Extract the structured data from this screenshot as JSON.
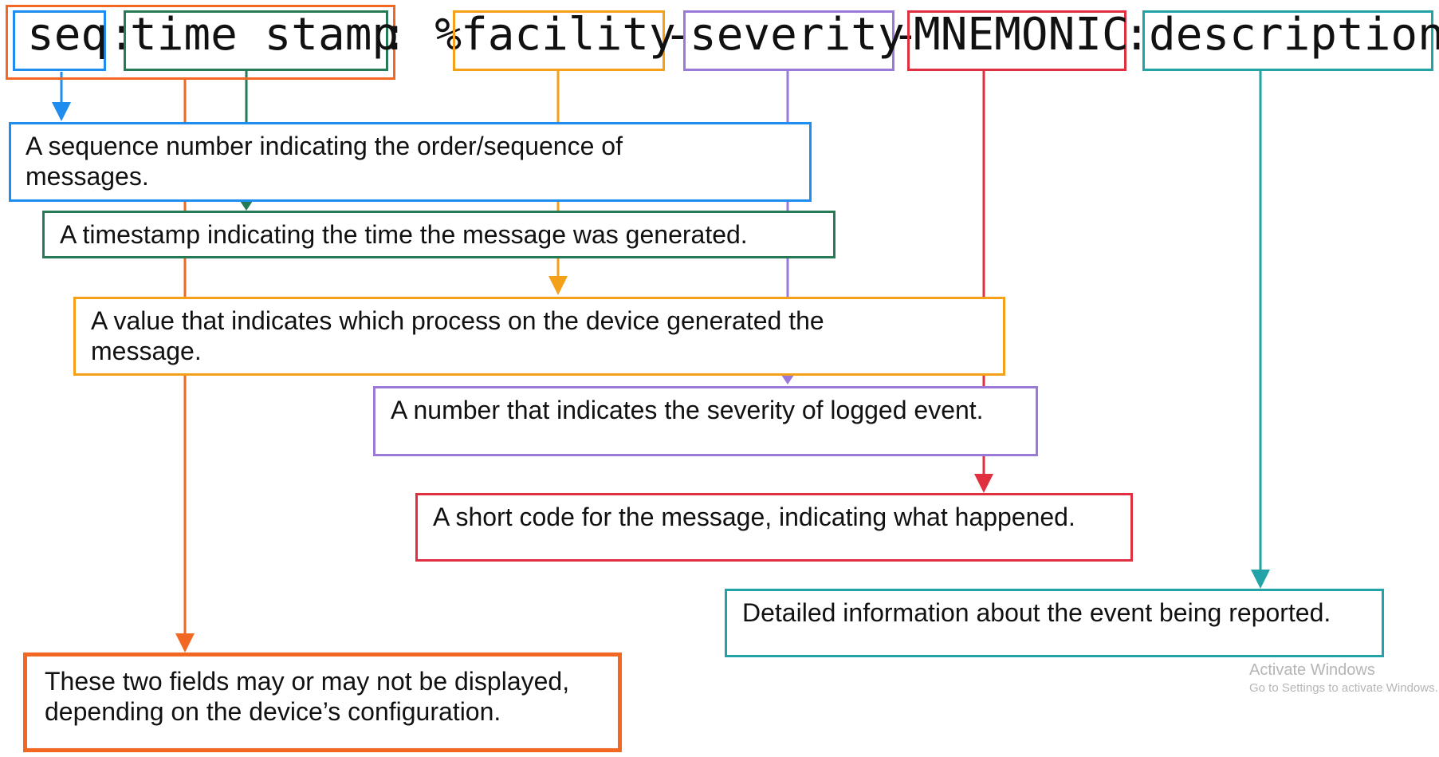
{
  "colors": {
    "seq": "#1f8cf0",
    "timestamp": "#267a56",
    "group": "#f26722",
    "facility": "#f5a019",
    "severity": "#9a79d8",
    "mnemonic": "#e0303f",
    "description": "#21a3a8"
  },
  "format": {
    "seq": "seq",
    "sep1": ":",
    "timestamp": "time stamp",
    "sep2": ": %",
    "facility": "facility",
    "sep3": "-",
    "severity": "severity",
    "sep4": "-",
    "mnemonic": "MNEMONIC",
    "sep5": ":",
    "description": "description"
  },
  "explanations": {
    "seq": "A sequence number indicating the order/sequence of messages.",
    "timestamp": "A timestamp indicating the time the message was generated.",
    "facility": "A value that indicates which process on the device generated the message.",
    "severity": "A number that indicates the severity of logged event.",
    "mnemonic": "A short code for the message, indicating what happened.",
    "description": "Detailed information about the event being reported.",
    "optional_note": "These two fields may or may not be displayed, depending on the device’s configuration."
  },
  "watermark": {
    "title": "Activate Windows",
    "subtitle": "Go to Settings to activate Windows."
  }
}
